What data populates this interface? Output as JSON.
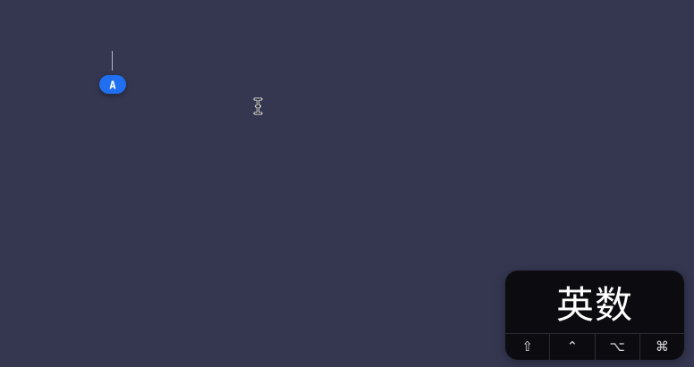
{
  "desktop": {
    "background_color": "#353751"
  },
  "input_indicator": {
    "letter": "A",
    "badge_color": "#1f6ff0"
  },
  "cursor": {
    "icon": "ibeam-cursor-icon"
  },
  "ime_hud": {
    "mode_label": "英数",
    "modifier_keys": [
      {
        "name": "shift",
        "glyph": "⇧"
      },
      {
        "name": "control",
        "glyph": "⌃"
      },
      {
        "name": "option",
        "glyph": "⌥"
      },
      {
        "name": "command",
        "glyph": "⌘"
      }
    ]
  }
}
